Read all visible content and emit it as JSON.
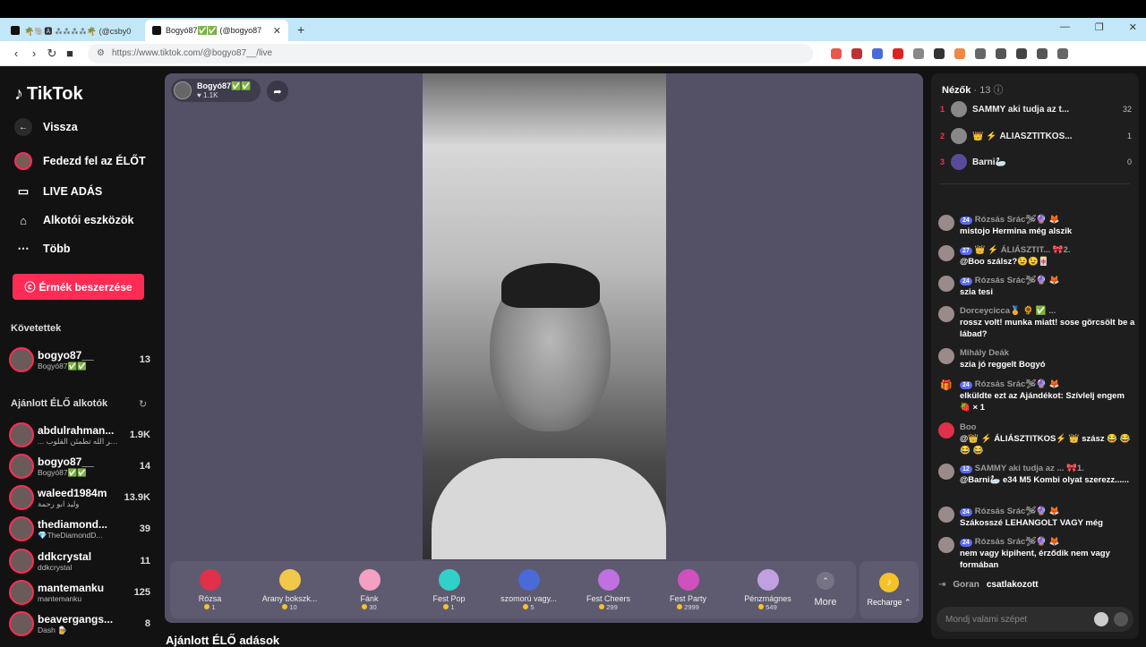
{
  "browser": {
    "tabs": [
      {
        "label": "🌴🐘🅰 ⁂⁂⁂⁂🌴 (@csby0"
      },
      {
        "label": "Bogyó87✅✅ (@bogyo87"
      }
    ],
    "url": "https://www.tiktok.com/@bogyo87__/live"
  },
  "sidebar": {
    "logo": "TikTok",
    "back": "Vissza",
    "explore": "Fedezd fel az ÉLŐT",
    "live": "LIVE ADÁS",
    "creator_tools": "Alkotói eszközök",
    "more": "Több",
    "coins_button": "Érmék beszerzése",
    "following_header": "Követettek",
    "following": [
      {
        "name": "bogyo87__",
        "sub": "Bogyó87✅✅",
        "count": "13"
      }
    ],
    "recommended_header": "Ajánlott ÉLŐ alkotók",
    "recommended": [
      {
        "name": "abdulrahman...",
        "sub": "... ألا بذكر الله تطمئن القلوب",
        "count": "1.9K"
      },
      {
        "name": "bogyo87__",
        "sub": "Bogyó87✅✅",
        "count": "14"
      },
      {
        "name": "waleed1984m",
        "sub": "وليد ابو رحمة",
        "count": "13.9K"
      },
      {
        "name": "thediamond...",
        "sub": "💎TheDiamondD...",
        "count": "39"
      },
      {
        "name": "ddkcrystal",
        "sub": "ddkcrystal",
        "count": "11"
      },
      {
        "name": "mantemanku",
        "sub": "mantemanku",
        "count": "125"
      },
      {
        "name": "beavergangs...",
        "sub": "Dash 🍺",
        "count": "8"
      }
    ]
  },
  "stream": {
    "host_name": "Bogyó87✅✅",
    "host_likes": "♥ 1.1K",
    "gifts": [
      {
        "name": "Rózsa",
        "price": "1",
        "color": "#e0304a"
      },
      {
        "name": "Arany bokszk...",
        "price": "10",
        "color": "#f2c84b"
      },
      {
        "name": "Fánk",
        "price": "30",
        "color": "#f4a0c0"
      },
      {
        "name": "Fest Pop",
        "price": "1",
        "color": "#31d0c8"
      },
      {
        "name": "szomorú vagy...",
        "price": "5",
        "color": "#4a6ad8"
      },
      {
        "name": "Fest Cheers",
        "price": "299",
        "color": "#c070e0"
      },
      {
        "name": "Fest Party",
        "price": "2999",
        "color": "#d050c0"
      },
      {
        "name": "Pénzmágnes",
        "price": "549",
        "color": "#c0a0e0"
      }
    ],
    "more_label": "More",
    "recharge_label": "Recharge ⌃"
  },
  "recommended_live_header": "Ajánlott ÉLŐ adások",
  "chat": {
    "viewers_label": "Nézők",
    "viewers_count": "· 13",
    "ranking": [
      {
        "rank": "1",
        "name": "SAMMY aki tudja az t...",
        "score": "32"
      },
      {
        "rank": "2",
        "name": "👑 ⚡ ÁLIÁSZTITKOS...",
        "score": "1"
      },
      {
        "rank": "3",
        "name": "Barni🦢",
        "score": "0"
      }
    ],
    "messages": [
      {
        "badge": "24",
        "user": "Rózsás Srác🛩🔮 🦊",
        "text": "mistojo Hermina még alszik"
      },
      {
        "badge": "27",
        "user": "👑 ⚡ ÁLIÁSZTIT... 🎀2.",
        "text": "@Boo szálsz?😉😉🀄"
      },
      {
        "badge": "24",
        "user": "Rózsás Srác🛩🔮 🦊",
        "text": "szia tesi"
      },
      {
        "badge": "",
        "user": "Dorceycicca🏅 🌻 ✅ ...",
        "text": "rossz volt! munka miatt! sose görcsölt be a lábad?"
      },
      {
        "badge": "",
        "user": "Mihály Deák",
        "text": "szia jó reggelt Bogyó"
      },
      {
        "badge": "24",
        "user": "Rózsás Srác🛩🔮 🦊",
        "text": "elküldte ezt az Ajándékot: Szívlelj engem 🍓 × 1"
      },
      {
        "badge": "",
        "user": "Boo",
        "text": "@👑 ⚡ ÁLIÁSZTITKOS⚡ 👑 szász 😂 😂 😂 😂"
      },
      {
        "badge": "12",
        "user": "SAMMY aki tudja az ... 🎀1.",
        "text": "@Barni🦢 e34 M5 Kombi olyat szerezz......"
      },
      {
        "badge": "24",
        "user": "Rózsás Srác🛩🔮 🦊",
        "text": "Szákosszé LEHANGOLT VAGY még"
      },
      {
        "badge": "24",
        "user": "Rózsás Srác🛩🔮 🦊",
        "text": "nem vagy kipihent, érződik nem vagy formában"
      }
    ],
    "join_user": "Goran",
    "join_text": "csatlakozott",
    "input_placeholder": "Mondj valami szépet"
  }
}
